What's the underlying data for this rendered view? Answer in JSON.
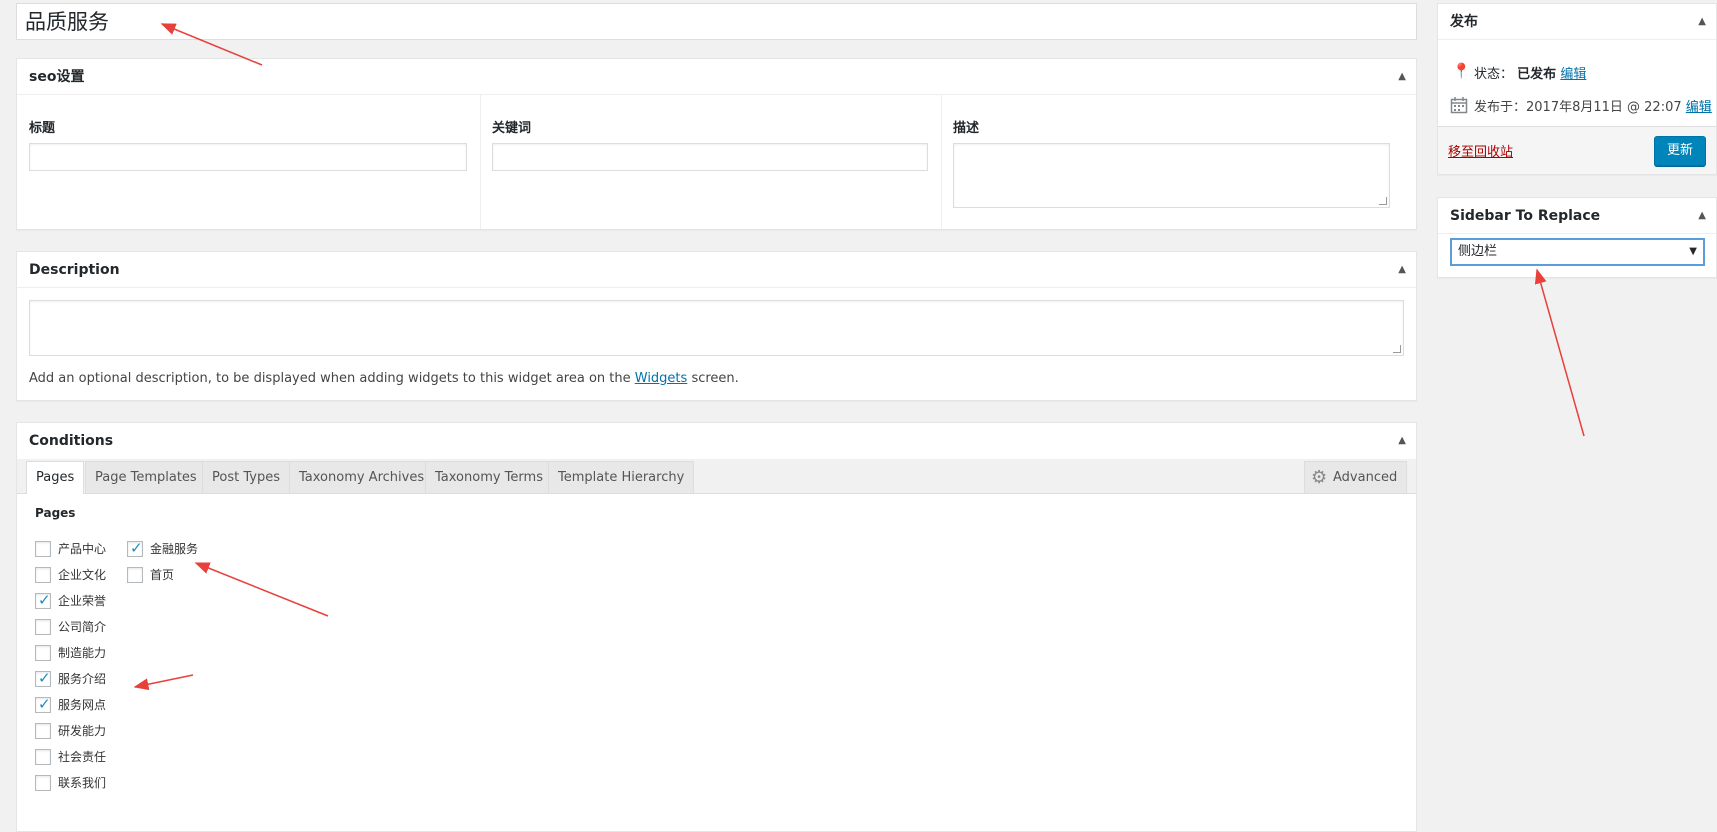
{
  "post": {
    "title": "品质服务"
  },
  "seo": {
    "heading": "seo设置",
    "fields": {
      "title_label": "标题",
      "keywords_label": "关键词",
      "description_label": "描述"
    }
  },
  "description_box": {
    "heading": "Description",
    "help_prefix": "Add an optional description, to be displayed when adding widgets to this widget area on the",
    "help_link": "Widgets",
    "help_suffix": "screen."
  },
  "conditions": {
    "heading": "Conditions",
    "tabs": [
      "Pages",
      "Page Templates",
      "Post Types",
      "Taxonomy Archives",
      "Taxonomy Terms",
      "Template Hierarchy"
    ],
    "advanced_label": "Advanced",
    "section_title": "Pages",
    "pages_col1": [
      {
        "label": "产品中心",
        "checked": false
      },
      {
        "label": "企业文化",
        "checked": false
      },
      {
        "label": "企业荣誉",
        "checked": true
      },
      {
        "label": "公司简介",
        "checked": false
      },
      {
        "label": "制造能力",
        "checked": false
      },
      {
        "label": "服务介绍",
        "checked": true
      },
      {
        "label": "服务网点",
        "checked": true
      },
      {
        "label": "研发能力",
        "checked": false
      },
      {
        "label": "社会责任",
        "checked": false
      },
      {
        "label": "联系我们",
        "checked": false
      }
    ],
    "pages_col2": [
      {
        "label": "金融服务",
        "checked": true
      },
      {
        "label": "首页",
        "checked": false
      }
    ]
  },
  "publish": {
    "heading": "发布",
    "status_label": "状态：",
    "status_value": "已发布",
    "edit_label": "编辑",
    "date_label": "发布于：2017年8月11日 @ 22:07",
    "date_edit_label": "编辑",
    "trash_label": "移至回收站",
    "update_label": "更新"
  },
  "sidebar_replace": {
    "heading": "Sidebar To Replace",
    "selected": "侧边栏"
  },
  "colors": {
    "accent": "#0085ba",
    "link": "#0073aa",
    "danger": "#a00",
    "annotation": "#e8403a"
  }
}
